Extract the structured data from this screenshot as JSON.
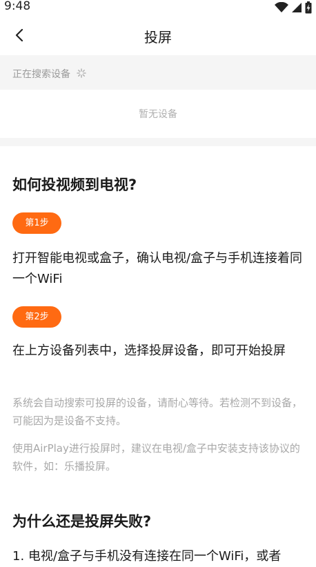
{
  "status": {
    "time": "9:48"
  },
  "nav": {
    "title": "投屏"
  },
  "search": {
    "status_text": "正在搜索设备"
  },
  "devices": {
    "empty_text": "暂无设备"
  },
  "guide": {
    "title": "如何投视频到电视?",
    "steps": [
      {
        "badge": "第1步",
        "text": "打开智能电视或盒子，确认电视/盒子与手机连接着同一个WiFi"
      },
      {
        "badge": "第2步",
        "text": "在上方设备列表中，选择投屏设备，即可开始投屏"
      }
    ],
    "notes": [
      "系统会自动搜索可投屏的设备，请耐心等待。若检测不到设备，可能因为是设备不支持。",
      "使用AirPlay进行投屏时，建议在电视/盒子中安装支持该协议的软件，如：乐播投屏。"
    ]
  },
  "failure": {
    "title": "为什么还是投屏失败?",
    "items": [
      "1. 电视/盒子与手机没有连接在同一个WiFi，或者"
    ]
  }
}
